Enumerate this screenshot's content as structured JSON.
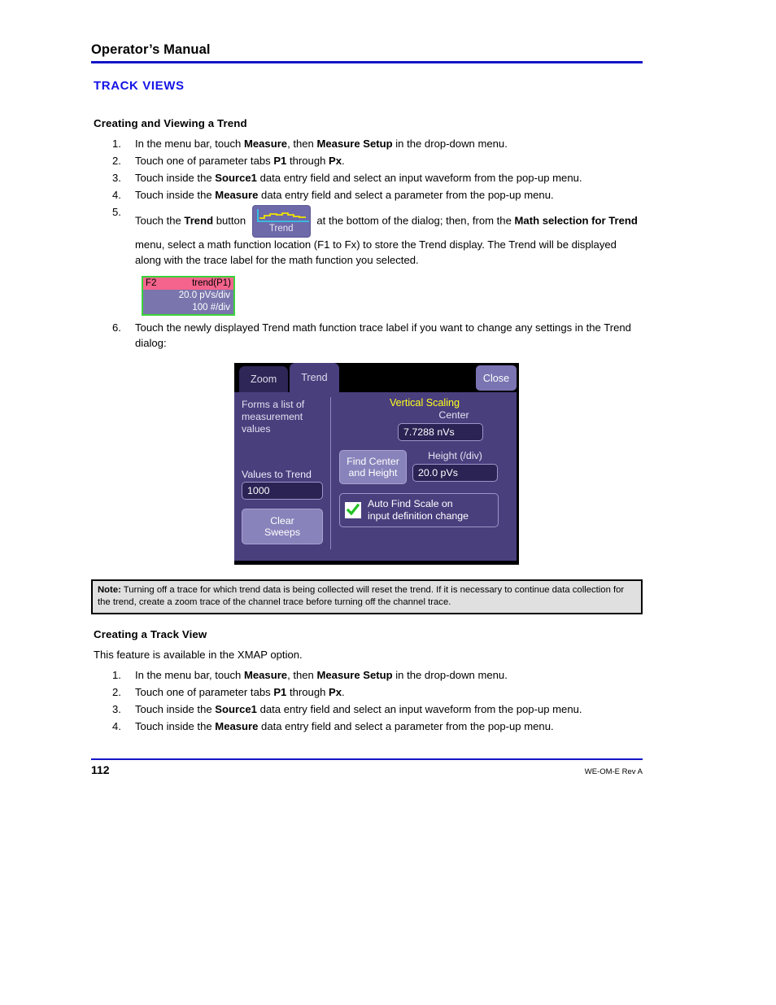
{
  "header": {
    "doc_title": "Operator’s Manual",
    "section_title": "TRACK VIEWS"
  },
  "section1": {
    "heading": "Creating and Viewing a Trend",
    "steps": [
      {
        "num": "1.",
        "parts": [
          {
            "t": "In the menu bar, touch ",
            "b": false
          },
          {
            "t": "Measure",
            "b": true
          },
          {
            "t": ", then ",
            "b": false
          },
          {
            "t": "Measure Setup",
            "b": true
          },
          {
            "t": " in the drop-down menu.",
            "b": false
          }
        ]
      },
      {
        "num": "2.",
        "parts": [
          {
            "t": "Touch one of parameter tabs ",
            "b": false
          },
          {
            "t": "P1",
            "b": true
          },
          {
            "t": " through ",
            "b": false
          },
          {
            "t": "Px",
            "b": true
          },
          {
            "t": ".",
            "b": false
          }
        ]
      },
      {
        "num": "3.",
        "parts": [
          {
            "t": "Touch inside the ",
            "b": false
          },
          {
            "t": "Source1",
            "b": true
          },
          {
            "t": " data entry field and select an input waveform from the pop-up menu.",
            "b": false
          }
        ]
      },
      {
        "num": "4.",
        "parts": [
          {
            "t": "Touch inside the ",
            "b": false
          },
          {
            "t": "Measure",
            "b": true
          },
          {
            "t": " data entry field and select a parameter from the pop-up menu.",
            "b": false
          }
        ]
      }
    ],
    "step5": {
      "num": "5.",
      "parts_a": [
        {
          "t": "Touch the ",
          "b": false
        },
        {
          "t": "Trend",
          "b": true
        },
        {
          "t": " button ",
          "b": false
        }
      ],
      "parts_b": [
        {
          "t": " at the bottom of the dialog; then, from the ",
          "b": false
        },
        {
          "t": "Math selection for Trend",
          "b": true
        },
        {
          "t": " menu, select a math function location (F1 to Fx) to store the Trend display. The Trend will be displayed along with the trace label for the math function you selected.",
          "b": false
        }
      ]
    },
    "step6": {
      "num": "6.",
      "parts": [
        {
          "t": "Touch the newly displayed Trend math function trace label if you want to change any settings in the Trend dialog:",
          "b": false
        }
      ]
    }
  },
  "trend_button": {
    "label": "Trend",
    "bg_color": "#6e69a8",
    "wave_color": "#f0e500",
    "axis_color": "#2ad4f0"
  },
  "trace_label": {
    "function": "F2",
    "title": "trend(P1)",
    "vertical_scale": "20.0 pVs/div",
    "horizontal_scale": "100 #/div",
    "header_color": "#f4648c",
    "body_color": "#7a76ad",
    "border_color": "#3cd23c"
  },
  "trend_dialog": {
    "tabs": [
      {
        "label": "Zoom",
        "active": false
      },
      {
        "label": "Trend",
        "active": true
      }
    ],
    "close_label": "Close",
    "left": {
      "hint_line1": "Forms a list of",
      "hint_line2": "measurement values",
      "values_to_trend_label": "Values to Trend",
      "values_to_trend_value": "1000",
      "clear_sweeps_line1": "Clear",
      "clear_sweeps_line2": "Sweeps"
    },
    "right": {
      "group_title": "Vertical Scaling",
      "center_label": "Center",
      "center_value": "7.7288 nVs",
      "find_center_line1": "Find Center",
      "find_center_line2": "and Height",
      "height_label": "Height (/div)",
      "height_value": "20.0 pVs",
      "auto_find_line1": "Auto Find Scale on",
      "auto_find_line2": "input definition change",
      "auto_find_checked": true
    },
    "accent_color": "#ffff1e",
    "panel_color": "#4a3f7d",
    "check_color": "#22c022"
  },
  "note": {
    "label": "Note:",
    "text": " Turning off a trace for which trend data is being collected will reset the trend. If it is necessary to continue data collection for the trend, create a zoom trace of the channel trace before turning off the channel trace."
  },
  "section2": {
    "heading": "Creating a Track View",
    "intro": "This feature is available in the XMAP option.",
    "steps": [
      {
        "num": "1.",
        "parts": [
          {
            "t": "In the menu bar, touch ",
            "b": false
          },
          {
            "t": "Measure",
            "b": true
          },
          {
            "t": ", then ",
            "b": false
          },
          {
            "t": "Measure Setup",
            "b": true
          },
          {
            "t": " in the drop-down menu.",
            "b": false
          }
        ]
      },
      {
        "num": "2.",
        "parts": [
          {
            "t": "Touch one of parameter tabs ",
            "b": false
          },
          {
            "t": "P1",
            "b": true
          },
          {
            "t": " through ",
            "b": false
          },
          {
            "t": "Px",
            "b": true
          },
          {
            "t": ".",
            "b": false
          }
        ]
      },
      {
        "num": "3.",
        "parts": [
          {
            "t": "Touch inside the ",
            "b": false
          },
          {
            "t": "Source1",
            "b": true
          },
          {
            "t": " data entry field and select an input waveform from the pop-up menu.",
            "b": false
          }
        ]
      },
      {
        "num": "4.",
        "parts": [
          {
            "t": "Touch inside the ",
            "b": false
          },
          {
            "t": "Measure",
            "b": true
          },
          {
            "t": " data entry field and select a parameter from the pop-up menu.",
            "b": false
          }
        ]
      }
    ]
  },
  "footer": {
    "page_number": "112",
    "doc_id": "WE-OM-E Rev A",
    "rule_color": "#1414c8"
  }
}
